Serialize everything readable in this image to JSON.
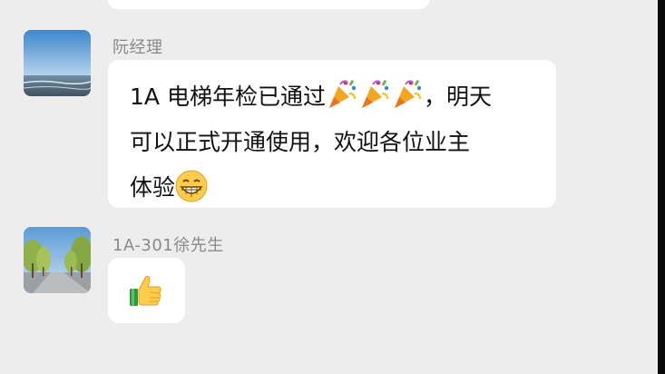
{
  "messages": [
    {
      "sender": "阮经理",
      "avatar": "sea-horizon-avatar",
      "text_line1": "1A 电梯年检已通过",
      "emojis_line1": [
        "party-popper-icon",
        "party-popper-icon",
        "party-popper-icon"
      ],
      "text_line1_tail": "，明天",
      "text_line2": "可以正式开通使用，欢迎各位业主",
      "text_line3": "体验",
      "emoji_line3": "grinning-face-icon"
    },
    {
      "sender": "1A-301徐先生",
      "avatar": "tree-lined-road-avatar",
      "emoji": "thumbs-up-icon"
    }
  ],
  "colors": {
    "background": "#ededed",
    "bubble": "#ffffff",
    "sender_text": "#8a8a8a",
    "message_text": "#111111"
  }
}
